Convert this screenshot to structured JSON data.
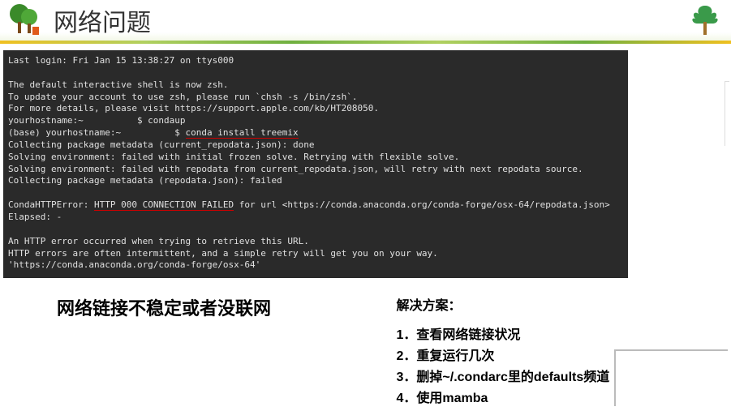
{
  "header": {
    "title": "网络问题"
  },
  "terminal": {
    "lastLogin": "Last login: Fri Jan 15 13:38:27 on ttys000",
    "zshNotice1": "The default interactive shell is now zsh.",
    "zshNotice2": "To update your account to use zsh, please run `chsh -s /bin/zsh`.",
    "zshNotice3": "For more details, please visit https://support.apple.com/kb/HT208050.",
    "prompt1": "yourhostname:~          $ condaup",
    "prompt2pre": "(base) yourhostname:~          $ ",
    "installCmd": "conda install treemix",
    "collecting1": "Collecting package metadata (current_repodata.json): done",
    "solving1": "Solving environment: failed with initial frozen solve. Retrying with flexible solve.",
    "solving2": "Solving environment: failed with repodata from current_repodata.json, will retry with next repodata source.",
    "collecting2": "Collecting package metadata (repodata.json): failed",
    "errPrefix": "CondaHTTPError: ",
    "errHighlight": "HTTP 000 CONNECTION FAILED",
    "errSuffix": " for url <https://conda.anaconda.org/conda-forge/osx-64/repodata.json>",
    "elapsed": "Elapsed: -",
    "httpErr1": "An HTTP error occurred when trying to retrieve this URL.",
    "httpErr2": "HTTP errors are often intermittent, and a simple retry will get you on your way.",
    "url": "'https://conda.anaconda.org/conda-forge/osx-64'"
  },
  "leftNote": "网络链接不稳定或者没联网",
  "solution": {
    "title": "解决方案：",
    "items": [
      "1．查看网络链接状况",
      "2．重复运行几次",
      "3．删掉~/.condarc里的defaults频道",
      "4．使用mamba"
    ]
  }
}
